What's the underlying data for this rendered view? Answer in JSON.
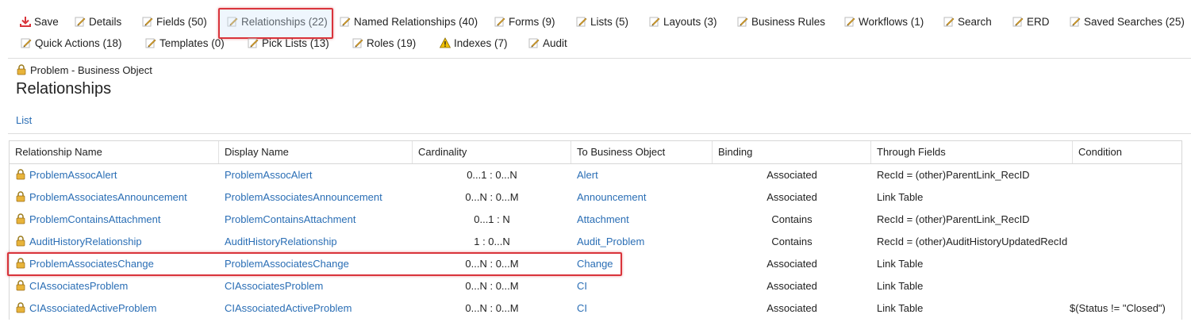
{
  "toolbar": {
    "items": [
      {
        "label": "Save",
        "icon": "save-icon"
      },
      {
        "label": "Details",
        "icon": "pencil-icon"
      },
      {
        "label": "Fields (50)",
        "icon": "pencil-icon"
      },
      {
        "label": "Relationships (22)",
        "icon": "pencil-icon",
        "selected": true
      },
      {
        "label": "Named Relationships (40)",
        "icon": "pencil-icon"
      },
      {
        "label": "Forms (9)",
        "icon": "pencil-icon"
      },
      {
        "label": "Lists (5)",
        "icon": "pencil-icon"
      },
      {
        "label": "Layouts (3)",
        "icon": "pencil-icon"
      },
      {
        "label": "Business Rules",
        "icon": "pencil-icon"
      },
      {
        "label": "Workflows (1)",
        "icon": "pencil-icon"
      },
      {
        "label": "Search",
        "icon": "pencil-icon"
      },
      {
        "label": "ERD",
        "icon": "pencil-icon"
      },
      {
        "label": "Saved Searches (25)",
        "icon": "pencil-icon"
      },
      {
        "label": "Quick Actions (18)",
        "icon": "pencil-icon"
      },
      {
        "label": "Templates (0)",
        "icon": "pencil-icon"
      },
      {
        "label": "Pick Lists (13)",
        "icon": "pencil-icon"
      },
      {
        "label": "Roles (19)",
        "icon": "pencil-icon"
      },
      {
        "label": "Indexes (7)",
        "icon": "warning-icon"
      },
      {
        "label": "Audit",
        "icon": "pencil-icon"
      }
    ]
  },
  "breadcrumb": "Problem - Business Object",
  "page_title": "Relationships",
  "list_link": "List",
  "colors": {
    "link": "#2a6eb5",
    "highlight": "#d9343b",
    "pencil": "#e8b43a"
  },
  "table": {
    "columns": [
      "Relationship Name",
      "Display Name",
      "Cardinality",
      "To Business Object",
      "Binding",
      "Through Fields",
      "Condition"
    ],
    "rows": [
      {
        "name": "ProblemAssocAlert",
        "display": "ProblemAssocAlert",
        "cardinality": "0...1 : 0...N",
        "to": "Alert",
        "binding": "Associated",
        "through": "RecId = (other)ParentLink_RecID",
        "condition": ""
      },
      {
        "name": "ProblemAssociatesAnnouncement",
        "display": "ProblemAssociatesAnnouncement",
        "cardinality": "0...N : 0...M",
        "to": "Announcement",
        "binding": "Associated",
        "through": "Link Table",
        "condition": ""
      },
      {
        "name": "ProblemContainsAttachment",
        "display": "ProblemContainsAttachment",
        "cardinality": "0...1 : N",
        "to": "Attachment",
        "binding": "Contains",
        "through": "RecId = (other)ParentLink_RecID",
        "condition": ""
      },
      {
        "name": "AuditHistoryRelationship",
        "display": "AuditHistoryRelationship",
        "cardinality": "1 : 0...N",
        "to": "Audit_Problem",
        "binding": "Contains",
        "through": "RecId = (other)AuditHistoryUpdatedRecId",
        "condition": ""
      },
      {
        "name": "ProblemAssociatesChange",
        "display": "ProblemAssociatesChange",
        "cardinality": "0...N : 0...M",
        "to": "Change",
        "binding": "Associated",
        "through": "Link Table",
        "condition": "",
        "highlighted": true
      },
      {
        "name": "CIAssociatesProblem",
        "display": "CIAssociatesProblem",
        "cardinality": "0...N : 0...M",
        "to": "CI",
        "binding": "Associated",
        "through": "Link Table",
        "condition": ""
      },
      {
        "name": "CIAssociatedActiveProblem",
        "display": "CIAssociatedActiveProblem",
        "cardinality": "0...N : 0...M",
        "to": "CI",
        "binding": "Associated",
        "through": "Link Table",
        "condition": "$(Status != \"Closed\")"
      }
    ]
  }
}
